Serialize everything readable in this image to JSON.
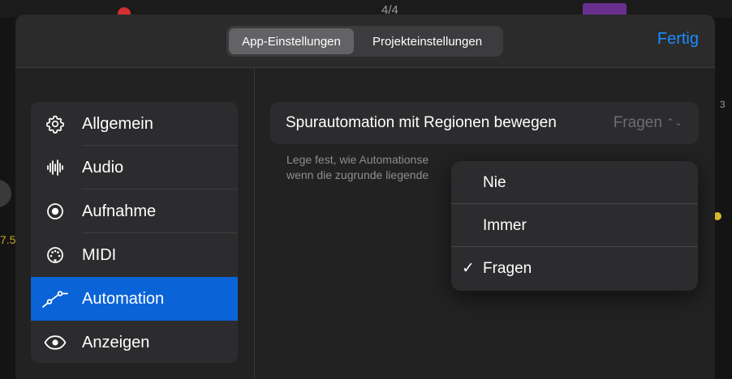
{
  "background": {
    "time_signature": "4/4",
    "left_number": "7.5",
    "right_number": "3"
  },
  "header": {
    "tabs": [
      {
        "label": "App-Einstellungen",
        "selected": true
      },
      {
        "label": "Projekteinstellungen",
        "selected": false
      }
    ],
    "done_label": "Fertig"
  },
  "sidebar": {
    "items": [
      {
        "label": "Allgemein",
        "icon": "gear-icon"
      },
      {
        "label": "Audio",
        "icon": "waveform-icon"
      },
      {
        "label": "Aufnahme",
        "icon": "record-icon"
      },
      {
        "label": "MIDI",
        "icon": "midi-icon"
      },
      {
        "label": "Automation",
        "icon": "automation-icon",
        "selected": true
      },
      {
        "label": "Anzeigen",
        "icon": "eye-icon"
      }
    ]
  },
  "main": {
    "setting_label": "Spurautomation mit Regionen bewegen",
    "setting_value": "Fragen",
    "description": "Lege fest, wie Automationse\nwenn die zugrunde liegende"
  },
  "dropdown": {
    "options": [
      {
        "label": "Nie",
        "checked": false
      },
      {
        "label": "Immer",
        "checked": false
      },
      {
        "label": "Fragen",
        "checked": true
      }
    ],
    "check_mark": "✓"
  },
  "colors": {
    "accent": "#1c8cff",
    "selection": "#0a64d8",
    "sheet_bg": "#222222",
    "group_bg": "#2c2c2e"
  }
}
